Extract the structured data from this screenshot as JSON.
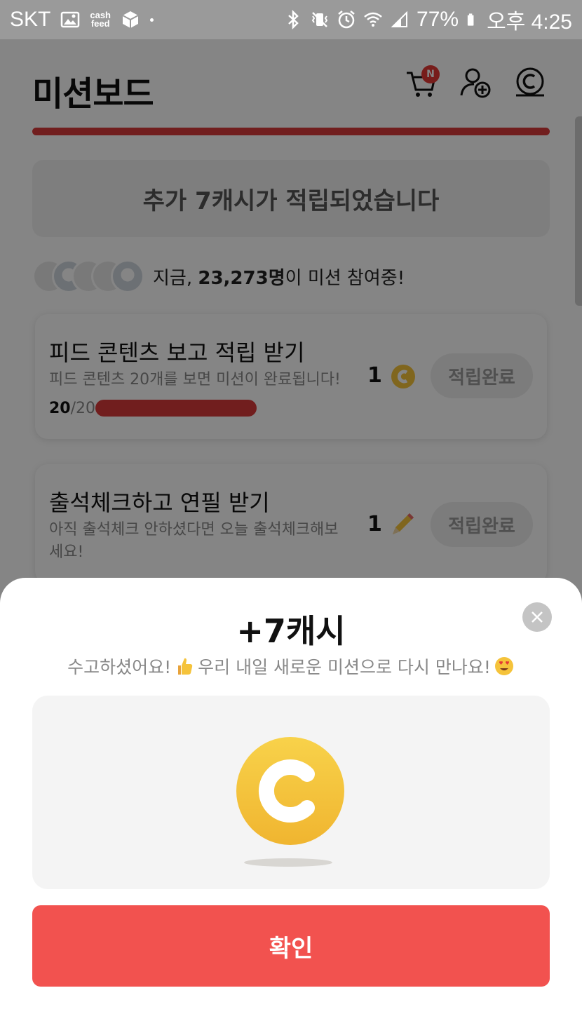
{
  "status_bar": {
    "carrier": "SKT",
    "cashfeed_line1": "cash",
    "cashfeed_line2": "feed",
    "battery": "77%",
    "time": "오후 4:25"
  },
  "header": {
    "title": "미션보드",
    "cart_badge": "N"
  },
  "banner": {
    "text": "추가 7캐시가 적립되었습니다"
  },
  "participants": {
    "prefix": "지금, ",
    "count": "23,273명",
    "suffix": "이 미션 참여중!"
  },
  "missions": [
    {
      "title": "피드 콘텐츠 보고 적립 받기",
      "desc": "피드 콘텐츠 20개를 보면 미션이 완료됩니다!",
      "progress_current": "20",
      "progress_total": "/20",
      "progress_fraction": 1.0,
      "reward_amount": "1",
      "reward_icon": "cash-coin-icon",
      "button": "적립완료"
    },
    {
      "title": "출석체크하고 연필 받기",
      "desc": "아직 출석체크 안하셨다면 오늘 출석체크해보세요!",
      "reward_amount": "1",
      "reward_icon": "pencil-icon",
      "button": "적립완료"
    }
  ],
  "sheet": {
    "title": "+7캐시",
    "subtitle_part1": "수고하셨어요!",
    "subtitle_part2": " 우리 내일 새로운 미션으로 다시 만나요!",
    "confirm": "확인"
  },
  "colors": {
    "accent_red": "#f2524f",
    "progress_red": "#d93a3a",
    "coin_yellow": "#f5c33b"
  }
}
